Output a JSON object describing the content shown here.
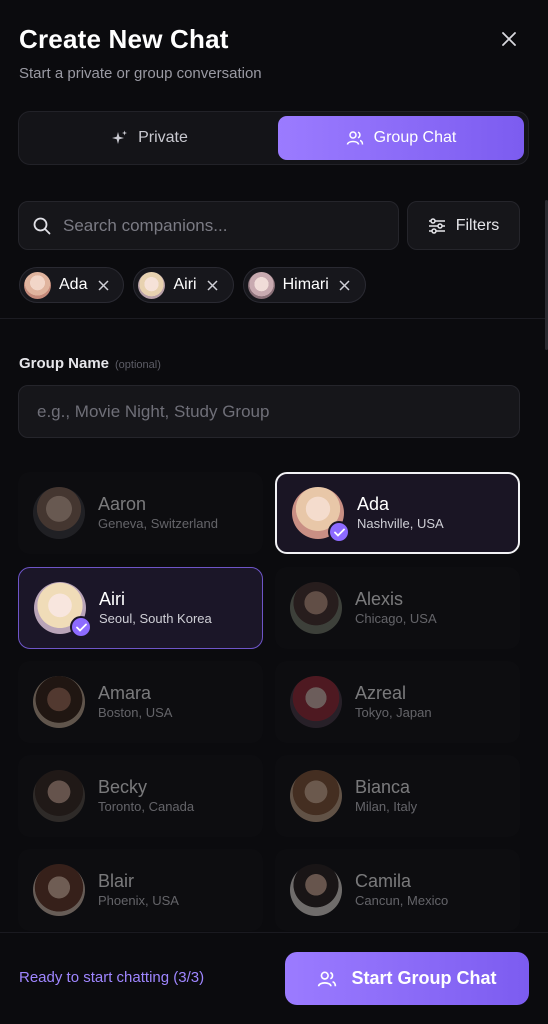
{
  "header": {
    "title": "Create New Chat",
    "subtitle": "Start a private or group conversation"
  },
  "tabs": [
    {
      "label": "Private",
      "icon": "sparkles-icon",
      "active": false
    },
    {
      "label": "Group Chat",
      "icon": "users-icon",
      "active": true
    }
  ],
  "search": {
    "placeholder": "Search companions...",
    "value": ""
  },
  "filters": {
    "label": "Filters",
    "icon": "sliders-icon"
  },
  "selected_chips": [
    {
      "name": "Ada"
    },
    {
      "name": "Airi"
    },
    {
      "name": "Himari"
    }
  ],
  "group_name": {
    "label": "Group Name",
    "optional": "(optional)",
    "placeholder": "e.g., Movie Night, Study Group",
    "value": ""
  },
  "companions": [
    {
      "name": "Aaron",
      "location": "Geneva, Switzerland",
      "selected": false
    },
    {
      "name": "Ada",
      "location": "Nashville, USA",
      "selected": true
    },
    {
      "name": "Airi",
      "location": "Seoul, South Korea",
      "selected": true
    },
    {
      "name": "Alexis",
      "location": "Chicago, USA",
      "selected": false
    },
    {
      "name": "Amara",
      "location": "Boston, USA",
      "selected": false
    },
    {
      "name": "Azreal",
      "location": "Tokyo, Japan",
      "selected": false
    },
    {
      "name": "Becky",
      "location": "Toronto, Canada",
      "selected": false
    },
    {
      "name": "Bianca",
      "location": "Milan, Italy",
      "selected": false
    },
    {
      "name": "Blair",
      "location": "Phoenix, USA",
      "selected": false
    },
    {
      "name": "Camila",
      "location": "Cancun, Mexico",
      "selected": false
    }
  ],
  "footer": {
    "status": "Ready to start chatting (3/3)",
    "button_label": "Start Group Chat"
  },
  "colors": {
    "accent": "#8d6bff",
    "background": "#0b0b0e",
    "status_text": "#9f86ff"
  }
}
